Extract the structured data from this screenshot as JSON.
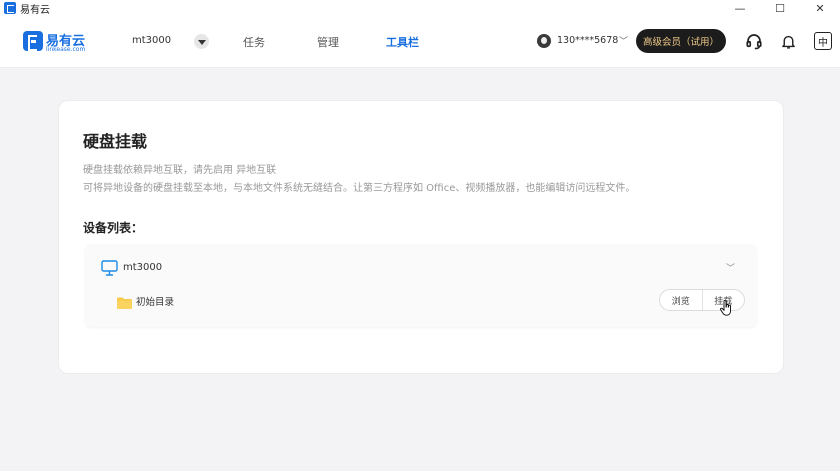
{
  "window": {
    "title": "易有云",
    "controls": [
      "—",
      "☐",
      "✕"
    ]
  },
  "brand": {
    "name": "易有云",
    "sub": "linkease.com"
  },
  "header": {
    "device": "mt3000",
    "tabs": [
      {
        "label": "任务"
      },
      {
        "label": "管理"
      },
      {
        "label": "工具栏"
      }
    ],
    "user_phone": "130****5678",
    "vip_label": "高级会员（试用）",
    "lang_label": "中"
  },
  "main": {
    "title": "硬盘挂载",
    "desc_line1": "硬盘挂载依赖异地互联，请先启用 异地互联",
    "desc_line2": "可将异地设备的硬盘挂载至本地，与本地文件系统无缝结合。让第三方程序如 Office、视频播放器，也能编辑访问远程文件。",
    "list_label": "设备列表：",
    "devices": [
      {
        "name": "mt3000",
        "folder": "初始目录",
        "browse_label": "浏览",
        "mount_label": "挂载"
      }
    ]
  },
  "colors": {
    "accent": "#1a6fe0",
    "vip_bg": "#1c1c1c",
    "vip_text": "#f0c98a",
    "folder": "#f7c948"
  }
}
